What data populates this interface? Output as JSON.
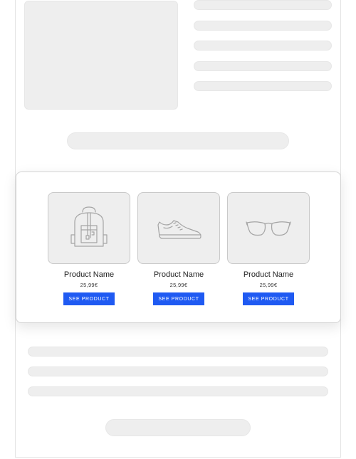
{
  "products": [
    {
      "name": "Product Name",
      "price": "25,99€",
      "button_label": "SEE PRODUCT",
      "icon": "backpack-icon"
    },
    {
      "name": "Product Name",
      "price": "25,99€",
      "button_label": "SEE PRODUCT",
      "icon": "sneaker-icon"
    },
    {
      "name": "Product Name",
      "price": "25,99€",
      "button_label": "SEE PRODUCT",
      "icon": "glasses-icon"
    }
  ],
  "colors": {
    "button": "#1f5af2",
    "placeholder": "#eeeeee",
    "card_border": "#d4d4d4"
  }
}
